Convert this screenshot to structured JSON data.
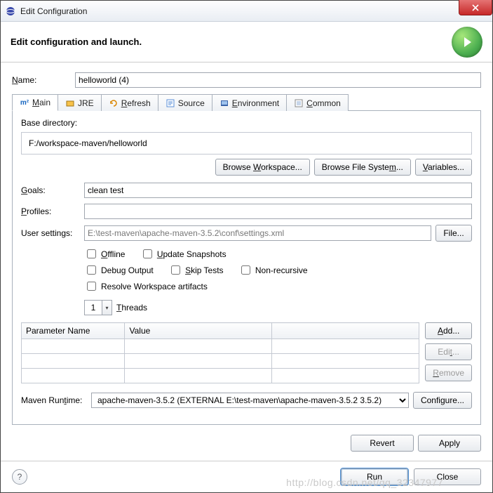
{
  "window": {
    "title": "Edit Configuration"
  },
  "banner": {
    "heading": "Edit configuration and launch."
  },
  "name": {
    "label": "Name:",
    "mnemonic": "N",
    "value": "helloworld (4)"
  },
  "tabs": {
    "items": [
      {
        "label": "Main",
        "mnemonic": "M"
      },
      {
        "label": "JRE"
      },
      {
        "label": "Refresh",
        "mnemonic": "R"
      },
      {
        "label": "Source"
      },
      {
        "label": "Environment",
        "mnemonic": "E"
      },
      {
        "label": "Common",
        "mnemonic": "C"
      }
    ]
  },
  "main": {
    "base_dir_label": "Base directory:",
    "base_dir_value": "F:/workspace-maven/helloworld",
    "browse_workspace": "Browse Workspace...",
    "browse_filesystem": "Browse File System...",
    "variables": "Variables...",
    "goals_label": "Goals:",
    "goals_mnemonic": "G",
    "goals_value": "clean test",
    "profiles_label": "Profiles:",
    "profiles_mnemonic": "P",
    "profiles_value": "",
    "user_settings_label": "User settings:",
    "user_settings_value": "E:\\test-maven\\apache-maven-3.5.2\\conf\\settings.xml",
    "file_btn": "File...",
    "checks": {
      "offline": "Offline",
      "update_snapshots": "Update Snapshots",
      "debug_output": "Debug Output",
      "skip_tests": "Skip Tests",
      "non_recursive": "Non-recursive",
      "resolve_ws": "Resolve Workspace artifacts"
    },
    "threads_label": "Threads",
    "threads_mnemonic": "T",
    "threads_value": "1",
    "table": {
      "col_param": "Parameter Name",
      "col_value": "Value",
      "add": "Add...",
      "edit": "Edit...",
      "remove": "Remove"
    },
    "runtime_label": "Maven Runtime:",
    "runtime_mnemonic": "t",
    "runtime_value": "apache-maven-3.5.2 (EXTERNAL E:\\test-maven\\apache-maven-3.5.2 3.5.2)",
    "configure": "Configure..."
  },
  "actions": {
    "revert": "Revert",
    "apply": "Apply"
  },
  "footer": {
    "run": "Run",
    "close": "Close"
  },
  "watermark": "http://blog.csdn.net/qq_32347977"
}
